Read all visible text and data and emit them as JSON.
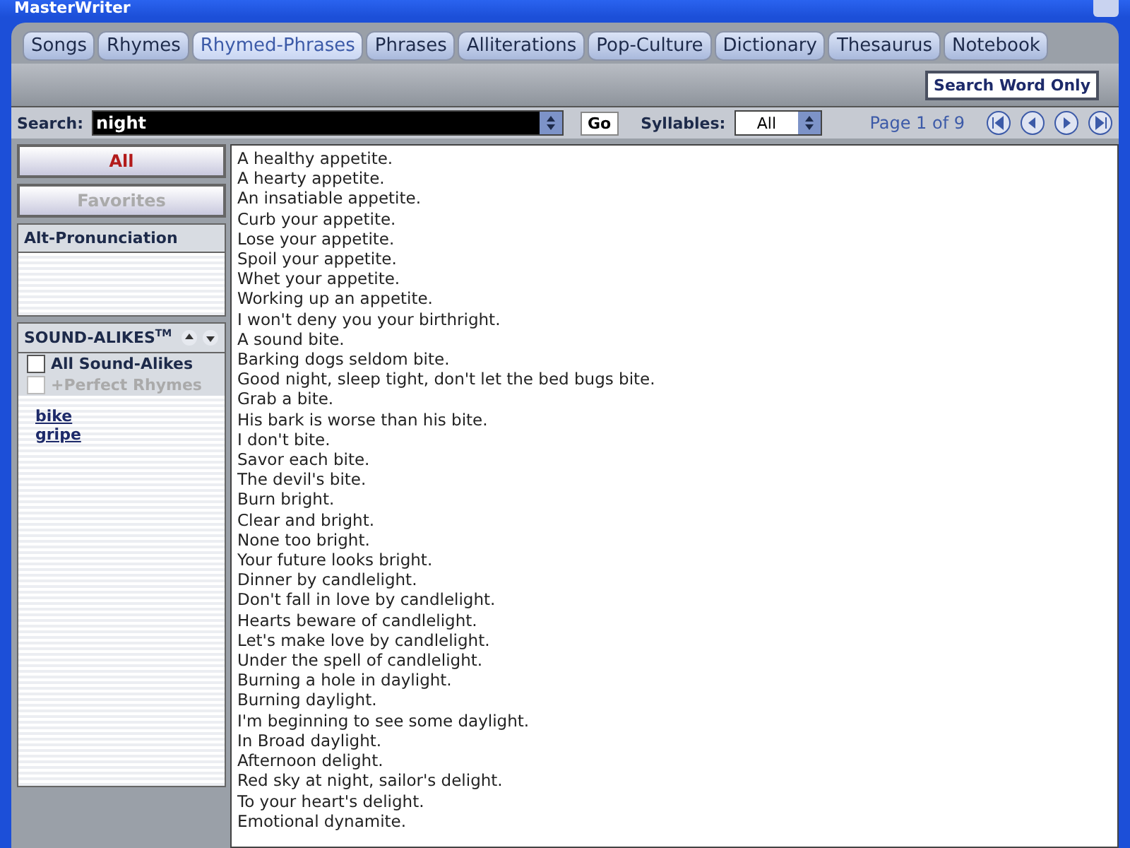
{
  "window": {
    "title": "MasterWriter"
  },
  "tabs": [
    {
      "label": "Songs",
      "selected": false
    },
    {
      "label": "Rhymes",
      "selected": false
    },
    {
      "label": "Rhymed-Phrases",
      "selected": true
    },
    {
      "label": "Phrases",
      "selected": false
    },
    {
      "label": "Alliterations",
      "selected": false
    },
    {
      "label": "Pop-Culture",
      "selected": false
    },
    {
      "label": "Dictionary",
      "selected": false
    },
    {
      "label": "Thesaurus",
      "selected": false
    },
    {
      "label": "Notebook",
      "selected": false
    }
  ],
  "search_word_only": {
    "label": "Search Word Only"
  },
  "search": {
    "label": "Search:",
    "value": "night",
    "go": "Go"
  },
  "syllables": {
    "label": "Syllables:",
    "value": "All"
  },
  "page": {
    "text": "Page 1 of 9"
  },
  "filters": [
    {
      "label": "All",
      "selected": true
    },
    {
      "label": "Favorites",
      "selected": false
    }
  ],
  "alt_pronunciation": {
    "title": "Alt-Pronunciation"
  },
  "sound_alikes": {
    "title": "SOUND-ALIKES",
    "mark": "TM",
    "options": [
      {
        "label": "All Sound-Alikes",
        "checked": false,
        "disabled": false
      },
      {
        "label": "+Perfect Rhymes",
        "checked": false,
        "disabled": true
      }
    ],
    "words": [
      "bike",
      "gripe"
    ]
  },
  "phrases": [
    "A healthy appetite.",
    "A hearty appetite.",
    "An insatiable appetite.",
    "Curb your appetite.",
    "Lose your appetite.",
    "Spoil your appetite.",
    "Whet your appetite.",
    "Working up an appetite.",
    "I won't deny you your birthright.",
    "A sound bite.",
    "Barking dogs seldom bite.",
    "Good night, sleep tight, don't let the bed bugs bite.",
    "Grab a bite.",
    "His bark is worse than his bite.",
    "I don't bite.",
    "Savor each bite.",
    "The devil's bite.",
    "Burn bright.",
    "Clear and bright.",
    "None too bright.",
    "Your future looks bright.",
    "Dinner by candlelight.",
    "Don't fall in love by candlelight.",
    "Hearts beware of candlelight.",
    "Let's make love by candlelight.",
    "Under the spell of candlelight.",
    "Burning a hole in daylight.",
    "Burning daylight.",
    "I'm beginning to see some daylight.",
    "In Broad daylight.",
    "Afternoon delight.",
    "Red sky at night, sailor's delight.",
    "To your heart's delight.",
    "Emotional dynamite."
  ]
}
